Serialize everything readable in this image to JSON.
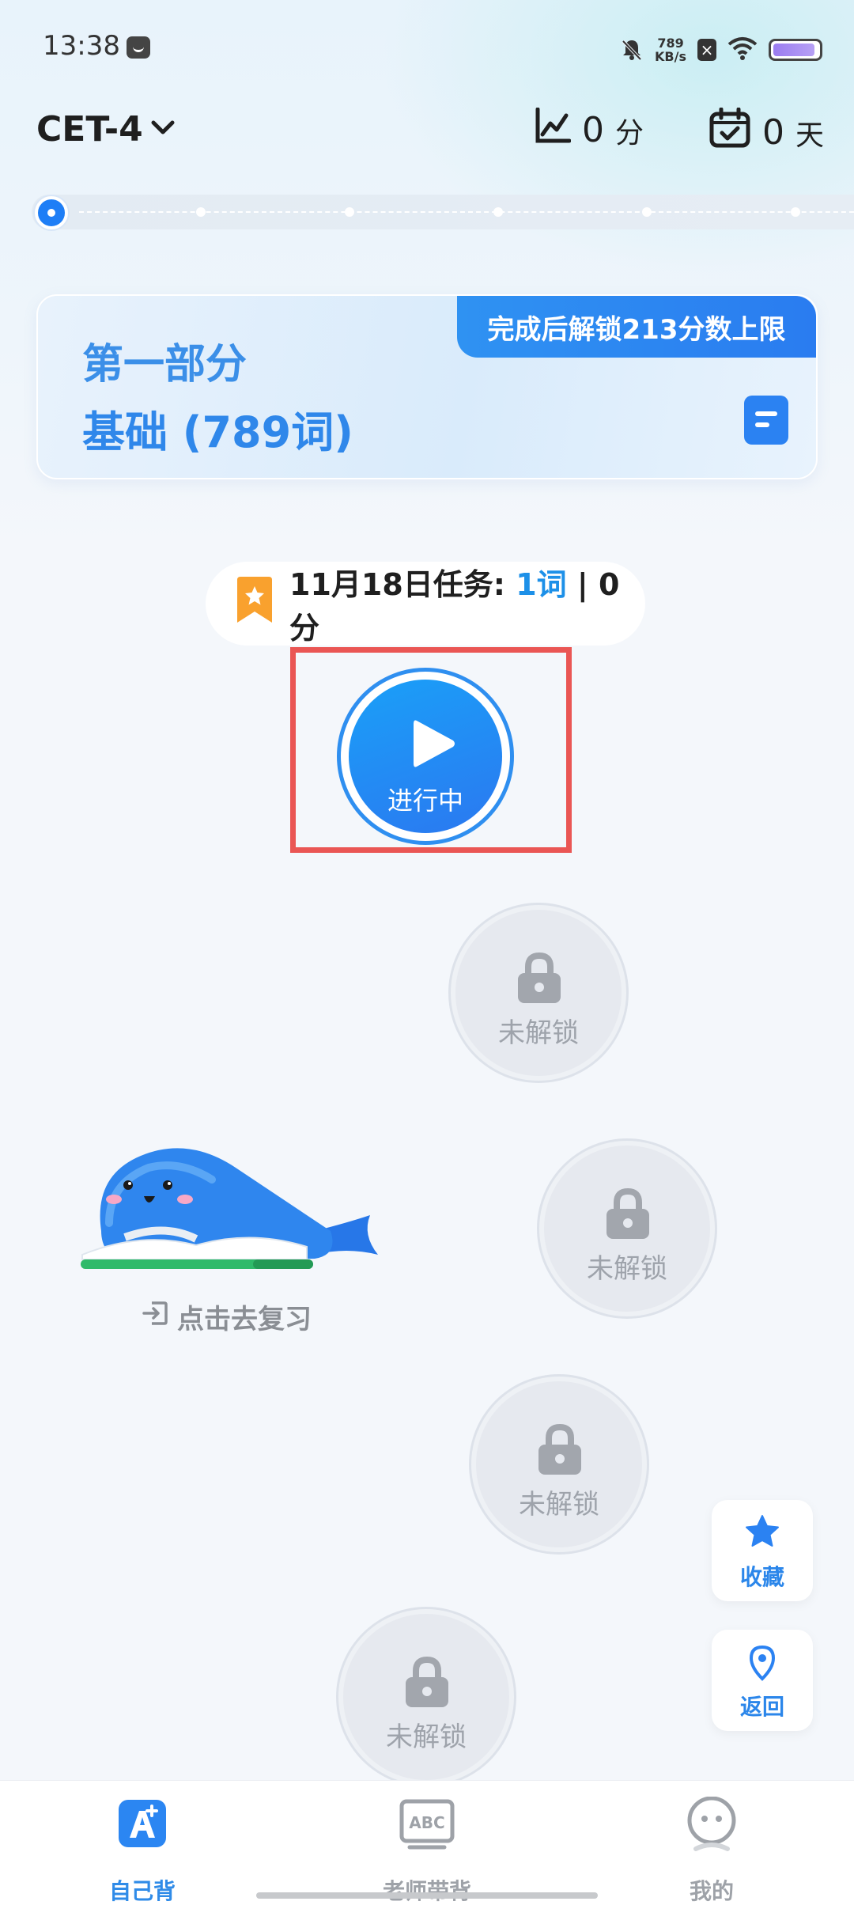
{
  "status_bar": {
    "time": "13:38",
    "net_speed_value": "789",
    "net_speed_unit": "KB/s",
    "sim_label": "×"
  },
  "header": {
    "level": "CET-4",
    "score_value": "0",
    "score_unit": "分",
    "days_value": "0",
    "days_unit": "天"
  },
  "section_card": {
    "banner": "完成后解锁213分数上限",
    "title": "第一部分",
    "subtitle": "基础 (789词)"
  },
  "task": {
    "prefix": "11月18日任务: ",
    "count": "1词",
    "suffix": " | 0分"
  },
  "active_node": {
    "label": "进行中"
  },
  "locked_nodes": [
    {
      "label": "未解锁"
    },
    {
      "label": "未解锁"
    },
    {
      "label": "未解锁"
    },
    {
      "label": "未解锁"
    }
  ],
  "review": {
    "label": "点击去复习"
  },
  "side_buttons": {
    "favorite": "收藏",
    "back": "返回"
  },
  "bottom_nav": [
    {
      "label": "自己背",
      "active": true
    },
    {
      "label": "老师带背",
      "active": false
    },
    {
      "label": "我的",
      "active": false
    }
  ],
  "colors": {
    "accent": "#2b82f2",
    "highlight": "#ea5654",
    "locked": "#e6e9ef"
  }
}
